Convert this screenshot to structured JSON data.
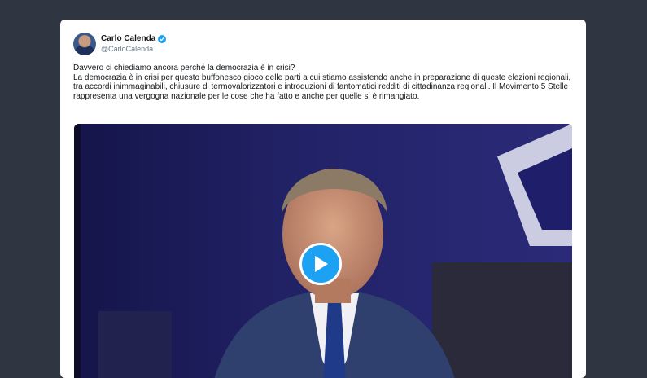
{
  "tweet": {
    "author": {
      "display_name": "Carlo Calenda",
      "handle": "@CarloCalenda",
      "verified": true
    },
    "text_lines": [
      "Davvero ci chiediamo ancora perché la democrazia è in crisi?",
      "La democrazia è in crisi per questo buffonesco gioco delle parti a cui stiamo assistendo anche in preparazione di queste elezioni regionali, tra accordi inimmaginabili, chiusure di termovalorizzatori e introduzioni di fantomatici redditi di cittadinanza regionali. Il Movimento 5 Stelle rappresenta una vergogna nazionale per le cose che ha fatto e anche per quelle si è rimangiato."
    ],
    "media": {
      "type": "video",
      "play_icon": "play-icon"
    }
  },
  "colors": {
    "background": "#2f3541",
    "card": "#ffffff",
    "accent": "#1da1f2",
    "text": "#14171a",
    "muted": "#657786"
  }
}
